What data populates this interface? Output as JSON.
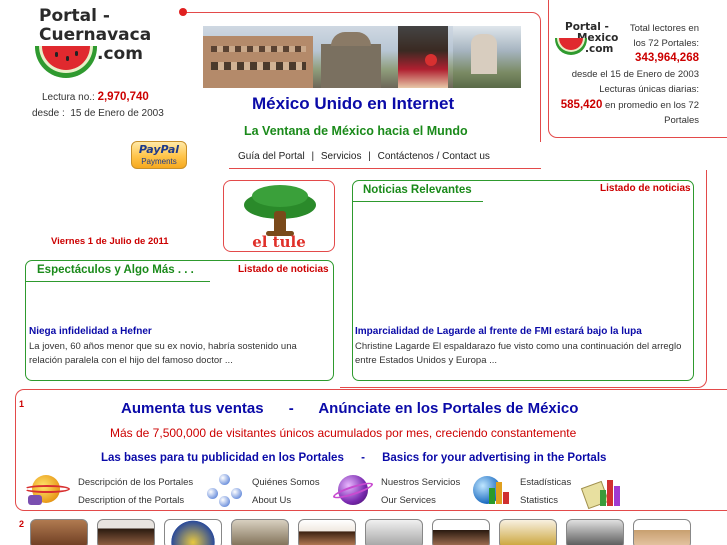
{
  "left_logo": {
    "line1": "Portal -",
    "line2": "Cuernavaca",
    "line3": ".com"
  },
  "reader_stats": {
    "label": "Lectura no.:",
    "count": "2,970,740",
    "since_label": "desde :",
    "since_date": "15 de Enero de 2003"
  },
  "right_logo": {
    "line1": "Portal -",
    "line2": "Mexico",
    "line3": ".com"
  },
  "total_stats": {
    "line1": "Total lectores en",
    "line2": "los 72 Portales:",
    "count": "343,964,268",
    "since": "desde el 15 de Enero de 2003",
    "daily_label": "Lecturas únicas diarias:",
    "daily_count": "585,420",
    "daily_suffix": "en promedio en los 72",
    "daily_suffix2": "Portales"
  },
  "header": {
    "title": "México Unido en Internet",
    "subtitle": "La Ventana de México hacia el Mundo"
  },
  "nav": {
    "items": [
      "Guía del Portal",
      "Servicios",
      "Contáctenos / Contact us"
    ],
    "separator": "|"
  },
  "paypal": {
    "brand": "PayPal",
    "label": "Payments"
  },
  "tule": {
    "label": "el tule"
  },
  "date": "Viernes 1 de Julio de 2011",
  "entertainment": {
    "tab": "Espectáculos y Algo Más . . .",
    "list_link": "Listado de noticias",
    "headline": "Niega infidelidad a Hefner",
    "body": "La joven, 60 años menor que su ex novio, habría sostenido una relación paralela con el hijo del famoso doctor ..."
  },
  "news": {
    "tab": "Noticias Relevantes",
    "list_link": "Listado de noticias",
    "headline": "Imparcialidad de Lagarde al frente de FMI estará bajo la lupa",
    "body": "Christine Lagarde El espaldarazo fue visto como una continuación del arreglo entre Estados Unidos y Europa ..."
  },
  "ads": {
    "number": "1",
    "headline_left": "Aumenta tus ventas",
    "headline_sep": "-",
    "headline_right": "Anúnciate en los Portales de México",
    "tagline": "Más de 7,500,000 de visitantes únicos acumulados por mes, creciendo constantemente",
    "bases_es": "Las bases para tu publicidad en los Portales",
    "bases_sep": "-",
    "bases_en": "Basics for your advertising in the Portals",
    "links": [
      {
        "es": "Descripción de los Portales",
        "en": "Description of the Portals"
      },
      {
        "es": "Quiénes Somos",
        "en": "About Us"
      },
      {
        "es": "Nuestros Servicios",
        "en": "Our Services"
      },
      {
        "es": "Estadísticas",
        "en": "Statistics"
      }
    ]
  },
  "section2": {
    "number": "2"
  },
  "colors": {
    "accent_red": "#cc0000",
    "link_blue": "#0a0aa8",
    "tab_green": "#1a8a1a",
    "frame_red": "#e34a4a"
  }
}
